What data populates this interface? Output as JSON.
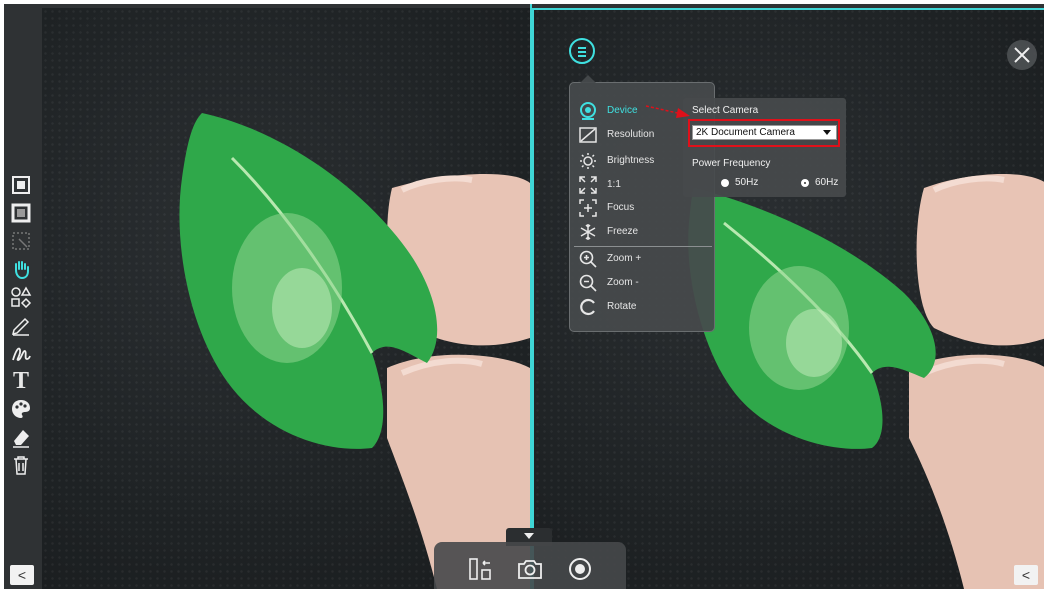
{
  "toolbar": {
    "icons": [
      "stop-square-icon",
      "frame-square-icon",
      "crop-icon",
      "hand-icon",
      "shapes-icon",
      "pen-icon",
      "freehand-icon",
      "text-icon",
      "palette-icon",
      "eraser-icon",
      "trash-icon"
    ],
    "text_glyph": "T",
    "collapse": "<"
  },
  "right_pane": {
    "collapse": "<"
  },
  "menu": {
    "items": [
      {
        "label": "Device",
        "icon": "webcam-icon",
        "active": true
      },
      {
        "label": "Resolution",
        "icon": "resolution-icon"
      },
      {
        "label": "Brightness",
        "icon": "brightness-icon"
      },
      {
        "label": "1:1",
        "icon": "fit-icon"
      },
      {
        "label": "Focus",
        "icon": "focus-icon"
      },
      {
        "label": "Freeze",
        "icon": "snowflake-icon"
      },
      {
        "label": "Zoom +",
        "icon": "zoom-in-icon"
      },
      {
        "label": "Zoom -",
        "icon": "zoom-out-icon"
      },
      {
        "label": "Rotate",
        "icon": "rotate-icon"
      }
    ]
  },
  "device_panel": {
    "select_camera_label": "Select Camera",
    "camera_value": "2K Document Camera",
    "power_frequency_label": "Power Frequency",
    "options": [
      {
        "label": "50Hz",
        "checked": false
      },
      {
        "label": "60Hz",
        "checked": true
      }
    ]
  },
  "bottom_bar": {
    "icons": [
      "split-view-icon",
      "camera-capture-icon",
      "record-icon"
    ]
  },
  "colors": {
    "accent": "#3fe0e0",
    "highlight": "#e0101a",
    "leaf": "#2fa84a"
  }
}
